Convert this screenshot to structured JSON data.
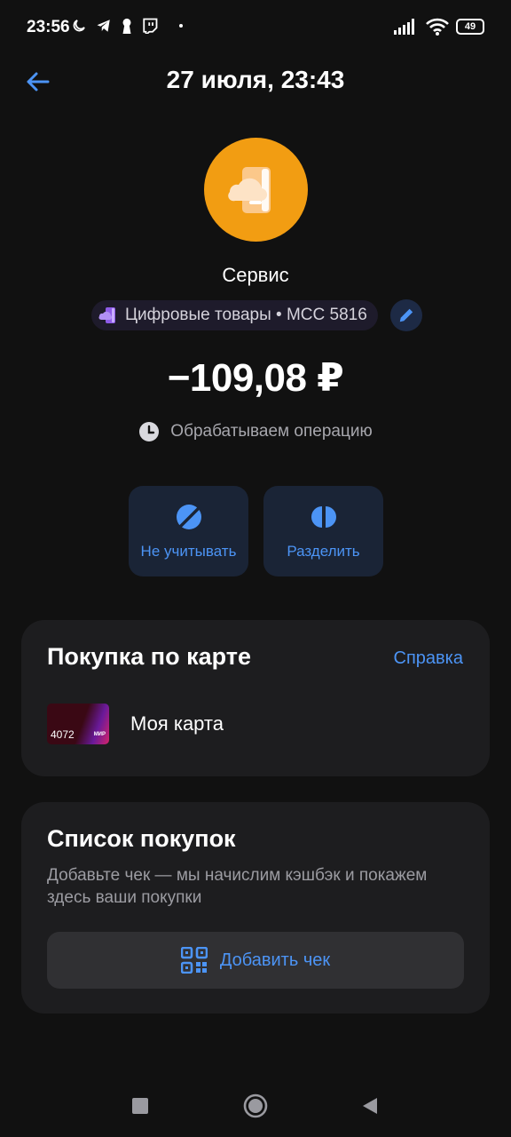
{
  "status_bar": {
    "time": "23:56",
    "battery": "49"
  },
  "header": {
    "title": "27 июля, 23:43"
  },
  "merchant": {
    "name": "Сервис",
    "avatar_color": "#f29d12",
    "category": "Цифровые товары • MCC 5816"
  },
  "transaction": {
    "amount": "−109,08 ₽",
    "status": "Обрабатываем операцию"
  },
  "actions": [
    {
      "label": "Не учитывать",
      "icon": "eye-off-icon"
    },
    {
      "label": "Разделить",
      "icon": "split-icon"
    }
  ],
  "card_section": {
    "title": "Покупка по карте",
    "help": "Справка",
    "card_number": "4072",
    "card_brand": "МИР",
    "card_name": "Моя карта"
  },
  "purchases_section": {
    "title": "Список покупок",
    "description": "Добавьте чек — мы начислим кэшбэк и покажем здесь ваши покупки",
    "button": "Добавить чек"
  },
  "colors": {
    "accent": "#4c94f5",
    "background": "#111111",
    "card": "#1d1d1f"
  }
}
